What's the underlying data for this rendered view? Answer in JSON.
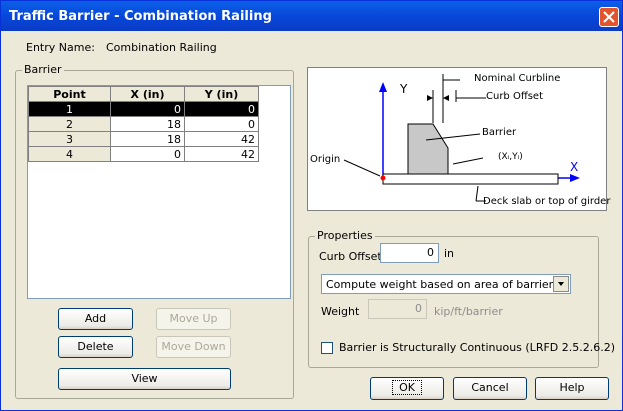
{
  "window": {
    "title": "Traffic Barrier - Combination Railing"
  },
  "entry": {
    "label": "Entry Name:",
    "value": "Combination Railing"
  },
  "barrier_group": {
    "title": "Barrier",
    "columns": [
      "Point",
      "X (in)",
      "Y (in)"
    ],
    "rows": [
      {
        "point": "1",
        "x": "0",
        "y": "0"
      },
      {
        "point": "2",
        "x": "18",
        "y": "0"
      },
      {
        "point": "3",
        "x": "18",
        "y": "42"
      },
      {
        "point": "4",
        "x": "0",
        "y": "42"
      }
    ],
    "buttons": {
      "add": "Add",
      "move_up": "Move Up",
      "delete": "Delete",
      "move_down": "Move Down",
      "view": "View"
    }
  },
  "diagram": {
    "axis_y": "Y",
    "axis_x": "X",
    "nominal_curbline": "Nominal Curbline",
    "curb_offset": "Curb Offset",
    "barrier": "Barrier",
    "point": "(Xᵢ,Yᵢ)",
    "origin": "Origin",
    "deck": "Deck slab or top of girder"
  },
  "properties": {
    "title": "Properties",
    "curb_offset_label": "Curb Offset",
    "curb_offset_value": "0",
    "curb_offset_unit": "in",
    "weight_mode": "Compute weight based on area of barrier",
    "weight_label": "Weight",
    "weight_value": "0",
    "weight_unit": "kip/ft/barrier",
    "continuous_label": "Barrier is Structurally Continuous (LRFD 2.5.2.6.2)"
  },
  "footer": {
    "ok": "OK",
    "cancel": "Cancel",
    "help": "Help"
  }
}
